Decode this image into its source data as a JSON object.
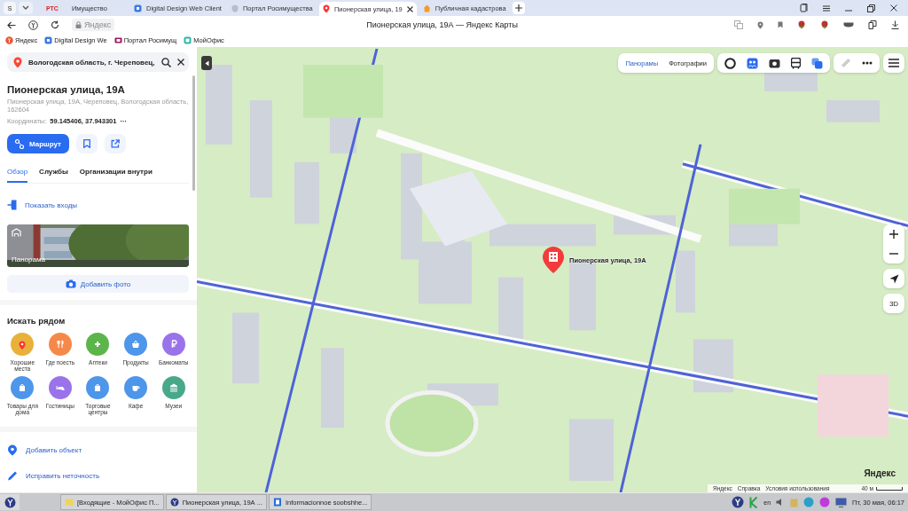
{
  "browser": {
    "profile": "S",
    "tabs": [
      {
        "label": "Имущество",
        "favicon_text": "РТС",
        "selected": false
      },
      {
        "label": "Digital Design Web Client",
        "selected": false
      },
      {
        "label": "Портал Росимущества",
        "selected": false
      },
      {
        "label": "Пионерская улица, 19",
        "selected": true
      },
      {
        "label": "Публичная кадастрова",
        "selected": false
      }
    ],
    "host": "Яндекс",
    "page_title": "Пионерская улица, 19А — Яндекс Карты",
    "bookmarks": [
      "Яндекс",
      "Digital Design We",
      "Портал Росимущ",
      "МойОфис"
    ]
  },
  "panel": {
    "search_value": "Вологодская область, г. Череповец,",
    "title": "Пионерская улица, 19А",
    "address": "Пионерская улица, 19А, Череповец, Вологодская область, 162604",
    "coords_label": "Координаты:",
    "coords": "59.145406, 37.943301",
    "coords_more": "···",
    "route_button": "Маршрут",
    "tabs": [
      {
        "label": "Обзор",
        "selected": true
      },
      {
        "label": "Службы",
        "selected": false
      },
      {
        "label": "Организации внутри",
        "selected": false
      }
    ],
    "entrances_link": "Показать входы",
    "panorama_label": "Панорама",
    "add_photo": "Добавить фото",
    "nearby_title": "Искать рядом",
    "nearby": [
      {
        "label": "Хорошие места",
        "color": "#e8b23a"
      },
      {
        "label": "Где поесть",
        "color": "#f5894a"
      },
      {
        "label": "Аптеки",
        "color": "#5cb54a"
      },
      {
        "label": "Продукты",
        "color": "#4d96ea"
      },
      {
        "label": "Банкоматы",
        "color": "#9a73ea"
      },
      {
        "label": "Товары для дома",
        "color": "#4d96ea"
      },
      {
        "label": "Гостиницы",
        "color": "#9a73ea"
      },
      {
        "label": "Торговые центры",
        "color": "#4d96ea"
      },
      {
        "label": "Кафе",
        "color": "#4d96ea"
      },
      {
        "label": "Музеи",
        "color": "#48a98a"
      }
    ],
    "actions": [
      "Добавить объект",
      "Исправить неточность"
    ]
  },
  "map": {
    "layer_tabs": [
      {
        "label": "Панорамы",
        "selected": true
      },
      {
        "label": "Фотографии",
        "selected": false
      }
    ],
    "marker_label": "Пионерская улица, 19А",
    "view_3d": "3D",
    "logo": "Яндекс",
    "attribution": [
      "Яндекс",
      "Справка",
      "Условия использования"
    ],
    "scale": "40 м"
  },
  "taskbar": {
    "items": [
      "[Входящие - МойОфис П...",
      "Пионерская улица, 19А ...",
      "Informacionnoe soobshhe..."
    ],
    "lang": "en",
    "clock": "Пт, 30 мая, 06:17"
  }
}
